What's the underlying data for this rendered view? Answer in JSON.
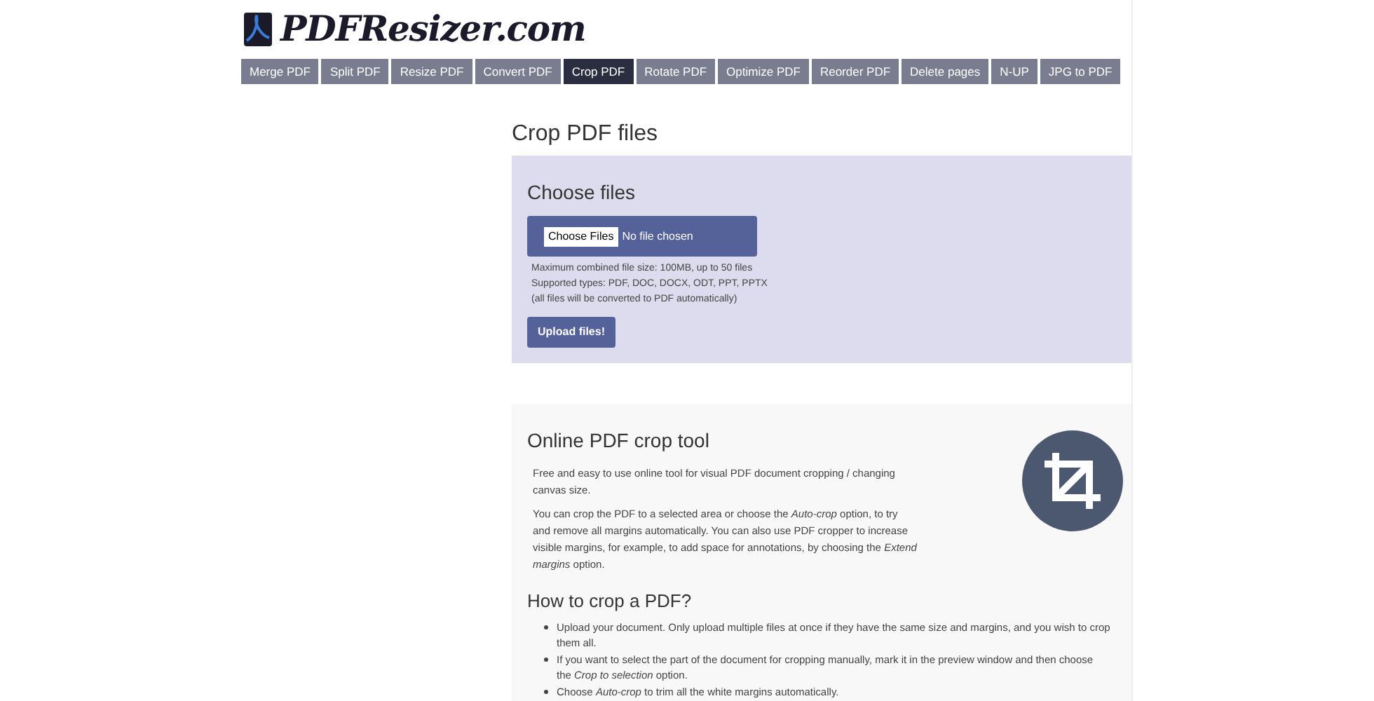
{
  "logo": {
    "text": "PDFResizer.com"
  },
  "tabs": [
    {
      "label": "Merge PDF",
      "selected": false
    },
    {
      "label": "Split PDF",
      "selected": false
    },
    {
      "label": "Resize PDF",
      "selected": false
    },
    {
      "label": "Convert PDF",
      "selected": false
    },
    {
      "label": "Crop PDF",
      "selected": true
    },
    {
      "label": "Rotate PDF",
      "selected": false
    },
    {
      "label": "Optimize PDF",
      "selected": false
    },
    {
      "label": "Reorder PDF",
      "selected": false
    },
    {
      "label": "Delete pages",
      "selected": false
    },
    {
      "label": "N-UP",
      "selected": false
    },
    {
      "label": "JPG to PDF",
      "selected": false
    }
  ],
  "page_title": "Crop PDF files",
  "upload": {
    "heading": "Choose files",
    "file_button": "Choose Files",
    "file_status": "No file chosen",
    "notes": [
      "Maximum combined file size: 100MB, up to 50 files",
      "Supported types: PDF, DOC, DOCX, ODT, PPT, PPTX",
      "(all files will be converted to PDF automatically)"
    ],
    "submit": "Upload files!"
  },
  "info": {
    "heading": "Online PDF crop tool",
    "paragraphs": [
      "Free and easy to use online tool for visual PDF document cropping / changing canvas size.",
      "You can crop the PDF to a selected area or choose the *Auto-crop* option, to try and remove all margins automatically. You can also use PDF cropper to increase visible margins, for example, to add space for annotations, by choosing the *Extend margins* option."
    ],
    "subheading": "How to crop a PDF?",
    "steps": [
      "Upload your document. Only upload multiple files at once if they have the same size and margins, and you wish to crop them all.",
      "If you want to select the part of the document for cropping manually, mark it in the preview window and then choose the *Crop to selection* option.",
      "Choose *Auto-crop* to trim all the white margins automatically."
    ]
  }
}
